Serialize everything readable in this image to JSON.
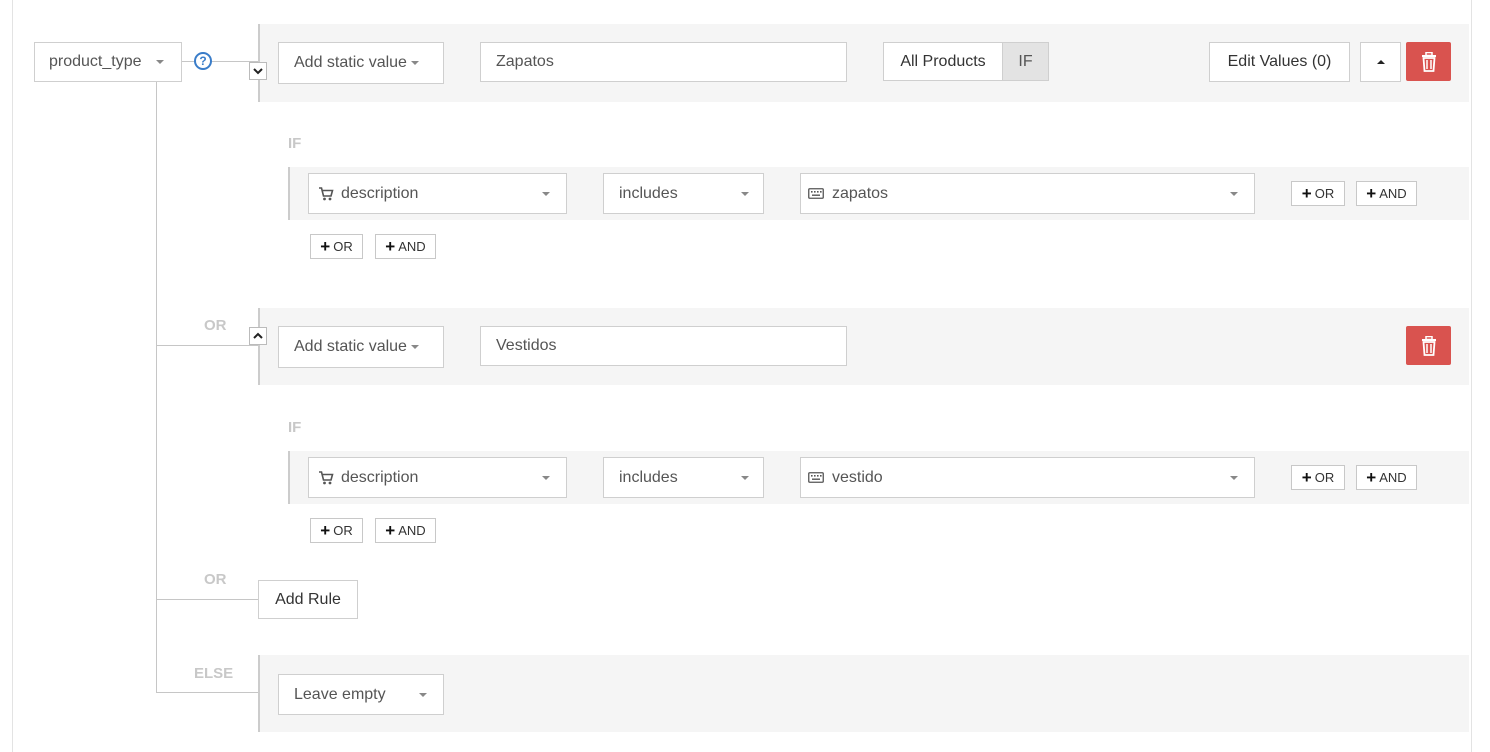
{
  "field_selector": {
    "label": "product_type",
    "help_icon": "question-circle-icon"
  },
  "rules": [
    {
      "value_type_label": "Add static value",
      "value": "Zapatos",
      "scope_all_label": "All Products",
      "scope_if_label": "IF",
      "edit_values_label": "Edit Values (0)",
      "condition_heading": "IF",
      "condition": {
        "field": "description",
        "field_icon": "cart-icon",
        "operator": "includes",
        "value_icon": "keyboard-icon",
        "value": "zapatos"
      },
      "or_label": "OR",
      "and_label": "AND"
    },
    {
      "connector": "OR",
      "value_type_label": "Add static value",
      "value": "Vestidos",
      "condition_heading": "IF",
      "condition": {
        "field": "description",
        "field_icon": "cart-icon",
        "operator": "includes",
        "value_icon": "keyboard-icon",
        "value": "vestido"
      },
      "or_label": "OR",
      "and_label": "AND"
    }
  ],
  "add_rule": {
    "connector": "OR",
    "label": "Add Rule"
  },
  "else_branch": {
    "label": "ELSE",
    "value": "Leave empty"
  },
  "colors": {
    "danger": "#d9534f",
    "help": "#3a7dc9",
    "band": "#f5f5f5"
  }
}
